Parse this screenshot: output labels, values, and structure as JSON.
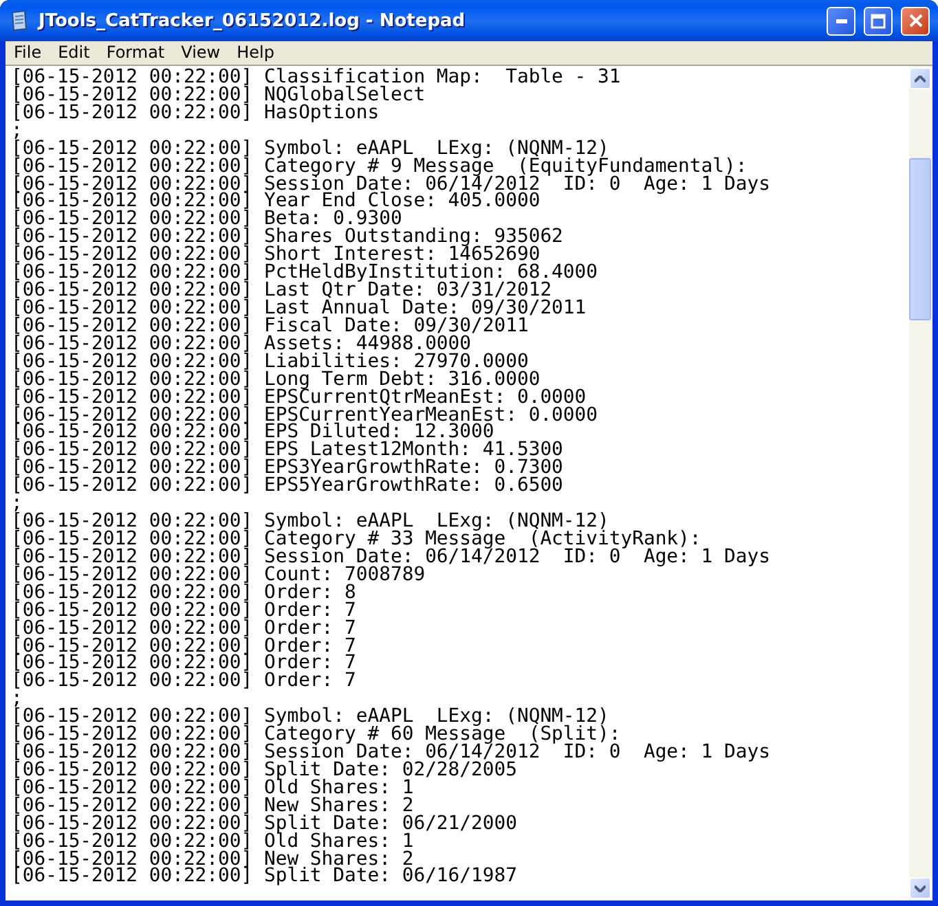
{
  "window": {
    "title": "JTools_CatTracker_06152012.log - Notepad"
  },
  "menu": [
    "File",
    "Edit",
    "Format",
    "View",
    "Help"
  ],
  "lines": [
    "[06-15-2012 00:22:00] Classification Map:  Table - 31",
    "[06-15-2012 00:22:00] NQGlobalSelect",
    "[06-15-2012 00:22:00] HasOptions",
    ";",
    "[06-15-2012 00:22:00] Symbol: eAAPL  LExg: (NQNM-12)",
    "[06-15-2012 00:22:00] Category # 9 Message  (EquityFundamental):",
    "[06-15-2012 00:22:00] Session Date: 06/14/2012  ID: 0  Age: 1 Days",
    "[06-15-2012 00:22:00] Year End Close: 405.0000",
    "[06-15-2012 00:22:00] Beta: 0.9300",
    "[06-15-2012 00:22:00] Shares Outstanding: 935062",
    "[06-15-2012 00:22:00] Short Interest: 14652690",
    "[06-15-2012 00:22:00] PctHeldByInstitution: 68.4000",
    "[06-15-2012 00:22:00] Last Qtr Date: 03/31/2012",
    "[06-15-2012 00:22:00] Last Annual Date: 09/30/2011",
    "[06-15-2012 00:22:00] Fiscal Date: 09/30/2011",
    "[06-15-2012 00:22:00] Assets: 44988.0000",
    "[06-15-2012 00:22:00] Liabilities: 27970.0000",
    "[06-15-2012 00:22:00] Long Term Debt: 316.0000",
    "[06-15-2012 00:22:00] EPSCurrentQtrMeanEst: 0.0000",
    "[06-15-2012 00:22:00] EPSCurrentYearMeanEst: 0.0000",
    "[06-15-2012 00:22:00] EPS Diluted: 12.3000",
    "[06-15-2012 00:22:00] EPS Latest12Month: 41.5300",
    "[06-15-2012 00:22:00] EPS3YearGrowthRate: 0.7300",
    "[06-15-2012 00:22:00] EPS5YearGrowthRate: 0.6500",
    ";",
    "[06-15-2012 00:22:00] Symbol: eAAPL  LExg: (NQNM-12)",
    "[06-15-2012 00:22:00] Category # 33 Message  (ActivityRank):",
    "[06-15-2012 00:22:00] Session Date: 06/14/2012  ID: 0  Age: 1 Days",
    "[06-15-2012 00:22:00] Count: 7008789",
    "[06-15-2012 00:22:00] Order: 8",
    "[06-15-2012 00:22:00] Order: 7",
    "[06-15-2012 00:22:00] Order: 7",
    "[06-15-2012 00:22:00] Order: 7",
    "[06-15-2012 00:22:00] Order: 7",
    "[06-15-2012 00:22:00] Order: 7",
    ";",
    "[06-15-2012 00:22:00] Symbol: eAAPL  LExg: (NQNM-12)",
    "[06-15-2012 00:22:00] Category # 60 Message  (Split):",
    "[06-15-2012 00:22:00] Session Date: 06/14/2012  ID: 0  Age: 1 Days",
    "[06-15-2012 00:22:00] Split Date: 02/28/2005",
    "[06-15-2012 00:22:00] Old Shares: 1",
    "[06-15-2012 00:22:00] New Shares: 2",
    "[06-15-2012 00:22:00] Split Date: 06/21/2000",
    "[06-15-2012 00:22:00] Old Shares: 1",
    "[06-15-2012 00:22:00] New Shares: 2",
    "[06-15-2012 00:22:00] Split Date: 06/16/1987"
  ]
}
